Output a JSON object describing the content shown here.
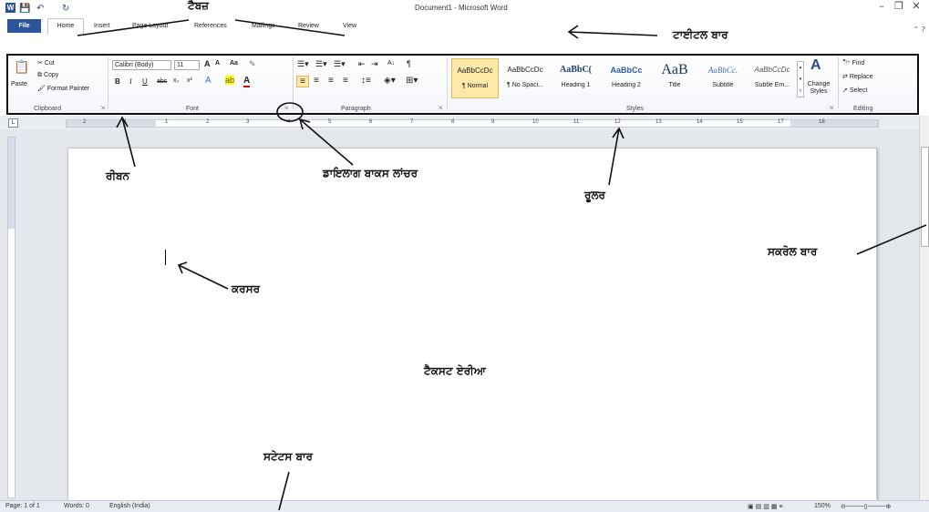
{
  "app": {
    "window_title": "Document1 - Microsoft Word",
    "logo_letter": "W"
  },
  "quick_access": {
    "save_glyph": "💾",
    "undo_glyph": "↶",
    "redo_glyph": "↻"
  },
  "window_controls": {
    "minimize": "–",
    "restore": "❐",
    "close": "✕"
  },
  "tabs": [
    {
      "label": "File"
    },
    {
      "label": "Home"
    },
    {
      "label": "Insert"
    },
    {
      "label": "Page Layout"
    },
    {
      "label": "References"
    },
    {
      "label": "Mailings"
    },
    {
      "label": "Review"
    },
    {
      "label": "View"
    }
  ],
  "ribbon": {
    "clipboard": {
      "paste": "Paste",
      "cut": "Cut",
      "copy": "Copy",
      "format_painter": "Format Painter",
      "group_label": "Clipboard"
    },
    "font": {
      "font_name": "Calibri (Body)",
      "font_size": "11",
      "grow": "A",
      "shrink": "A",
      "change_case": "Aa",
      "bold": "B",
      "italic": "I",
      "underline": "U",
      "strike": "abc",
      "subscript": "x₂",
      "superscript": "x²",
      "font_color": "A",
      "group_label": "Font"
    },
    "paragraph": {
      "sort": "A↓",
      "pilcrow": "¶",
      "group_label": "Paragraph"
    },
    "styles": {
      "items": [
        {
          "sample": "AaBbCcDc",
          "name": "¶ Normal"
        },
        {
          "sample": "AaBbCcDc",
          "name": "¶ No Spaci..."
        },
        {
          "sample": "AaBbC(",
          "name": "Heading 1"
        },
        {
          "sample": "AaBbCc",
          "name": "Heading 2"
        },
        {
          "sample": "AaB",
          "name": "Title"
        },
        {
          "sample": "AaBbCc.",
          "name": "Subtitle"
        },
        {
          "sample": "AaBbCcDc",
          "name": "Subtle Em..."
        }
      ],
      "change_styles": "Change Styles",
      "group_label": "Styles"
    },
    "editing": {
      "find": "Find",
      "replace": "Replace",
      "select": "Select",
      "group_label": "Editing"
    }
  },
  "ruler": {
    "numbers": [
      "2",
      "1",
      "1",
      "2",
      "3",
      "4",
      "5",
      "6",
      "7",
      "8",
      "9",
      "10",
      "11",
      "12",
      "13",
      "14",
      "15",
      "17",
      "18"
    ]
  },
  "statusbar": {
    "page": "Page: 1 of 1",
    "words": "Words: 0",
    "language": "English (India)",
    "zoom": "150%"
  },
  "annotations": {
    "tabs": "ਟੈਬਜ਼",
    "title_bar": "ਟਾਈਟਲ ਬਾਰ",
    "ribbon": "ਰੀਬਨ",
    "dialog_launcher": "ਡਾਇਲਾਗ ਬਾਕਸ ਲਾਂਚਰ",
    "ruler": "ਰੂਲਰ",
    "scroll_bar": "ਸਕਰੋਲ ਬਾਰ",
    "cursor": "ਕਰਸਰ",
    "text_area": "ਟੈਕਸਟ ਏਰੀਆ",
    "status_bar": "ਸਟੇਟਸ ਬਾਰ"
  }
}
